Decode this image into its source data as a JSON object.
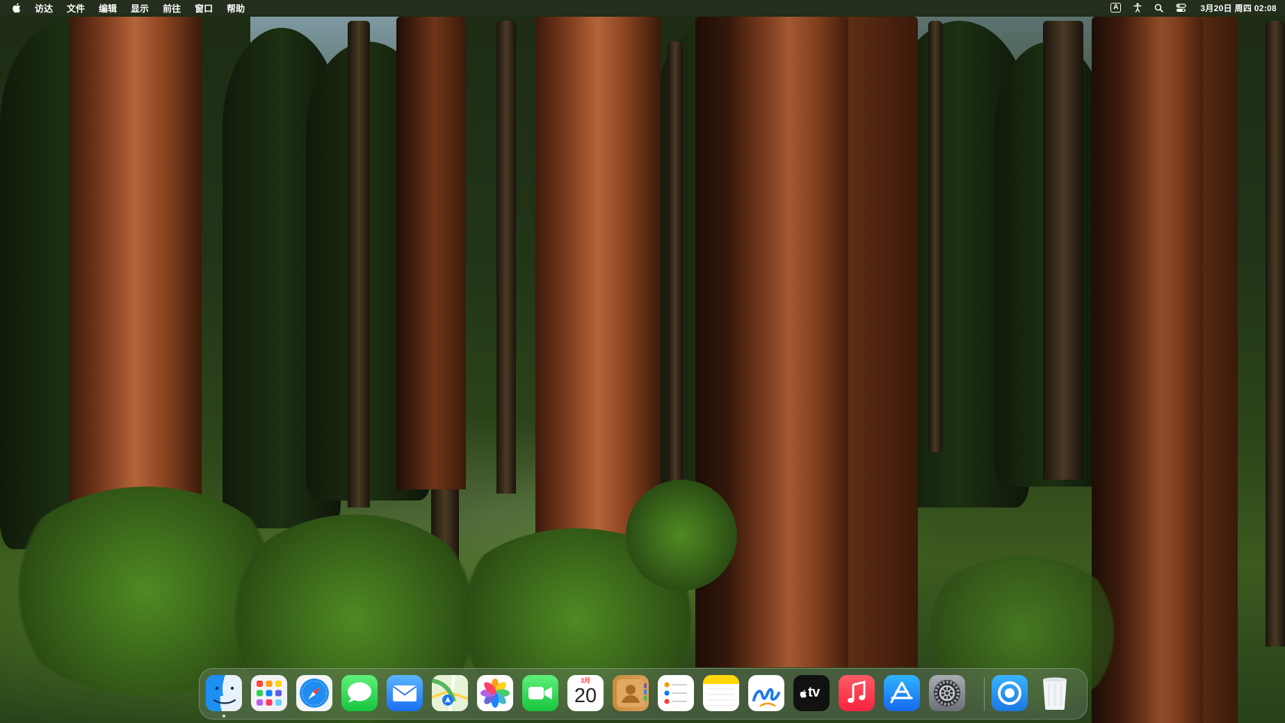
{
  "menubar": {
    "apple_icon": "apple-logo-icon",
    "items": [
      "访达",
      "文件",
      "编辑",
      "显示",
      "前往",
      "窗口",
      "帮助"
    ],
    "status": {
      "input_source": "A",
      "icons": [
        "input-source-icon",
        "accessibility-icon",
        "spotlight-search-icon",
        "control-center-icon"
      ],
      "clock": "3月20日 周四 02:08"
    }
  },
  "dock": {
    "apps": [
      {
        "name": "finder",
        "icon": "finder-icon",
        "running": true
      },
      {
        "name": "launchpad",
        "icon": "launchpad-icon"
      },
      {
        "name": "safari",
        "icon": "safari-icon"
      },
      {
        "name": "messages",
        "icon": "messages-icon"
      },
      {
        "name": "mail",
        "icon": "mail-icon"
      },
      {
        "name": "maps",
        "icon": "maps-icon"
      },
      {
        "name": "photos",
        "icon": "photos-icon"
      },
      {
        "name": "facetime",
        "icon": "facetime-icon"
      },
      {
        "name": "calendar",
        "icon": "calendar-icon",
        "month": "3月",
        "day": "20"
      },
      {
        "name": "contacts",
        "icon": "contacts-icon"
      },
      {
        "name": "reminders",
        "icon": "reminders-icon"
      },
      {
        "name": "notes",
        "icon": "notes-icon"
      },
      {
        "name": "freeform",
        "icon": "freeform-icon"
      },
      {
        "name": "tv",
        "icon": "apple-tv-icon",
        "label": "tv"
      },
      {
        "name": "music",
        "icon": "music-icon"
      },
      {
        "name": "app-store",
        "icon": "app-store-icon"
      },
      {
        "name": "system-settings",
        "icon": "system-settings-icon"
      }
    ],
    "extras": [
      {
        "name": "screen-recorder",
        "icon": "screen-recorder-icon"
      },
      {
        "name": "trash",
        "icon": "trash-icon"
      }
    ]
  },
  "colors": {
    "menubar_text": "#ffffff",
    "safari_blue": "#1e8cf0",
    "messages_green": "#34c759",
    "music_red": "#fa2d48",
    "notes_yellow": "#ffd60a"
  }
}
